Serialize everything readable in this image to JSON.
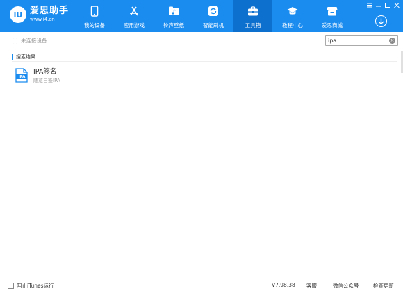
{
  "app": {
    "name": "爱思助手",
    "url": "www.i4.cn",
    "logo_mark": "iU"
  },
  "nav": [
    {
      "label": "我的设备",
      "icon": "phone-icon"
    },
    {
      "label": "应用游戏",
      "icon": "app-store-icon"
    },
    {
      "label": "铃声壁纸",
      "icon": "music-folder-icon"
    },
    {
      "label": "智能刷机",
      "icon": "flash-icon"
    },
    {
      "label": "工具箱",
      "icon": "toolbox-icon",
      "active": true
    },
    {
      "label": "教程中心",
      "icon": "graduation-cap-icon"
    },
    {
      "label": "爱思商城",
      "icon": "store-icon"
    }
  ],
  "toolbar": {
    "device_status": "未连接设备",
    "search_value": "ipa"
  },
  "results": {
    "section_title": "搜索结果",
    "items": [
      {
        "icon_text": "IPA",
        "title": "IPA签名",
        "subtitle": "随意自签IPA"
      }
    ]
  },
  "statusbar": {
    "itunes_label": "阻止iTunes运行",
    "version": "V7.98.38",
    "customer_service": "客服",
    "wechat": "微信公众号",
    "check_update": "检查更新"
  },
  "colors": {
    "accent": "#1a8cf0",
    "active_tab": "#0d6fce"
  }
}
